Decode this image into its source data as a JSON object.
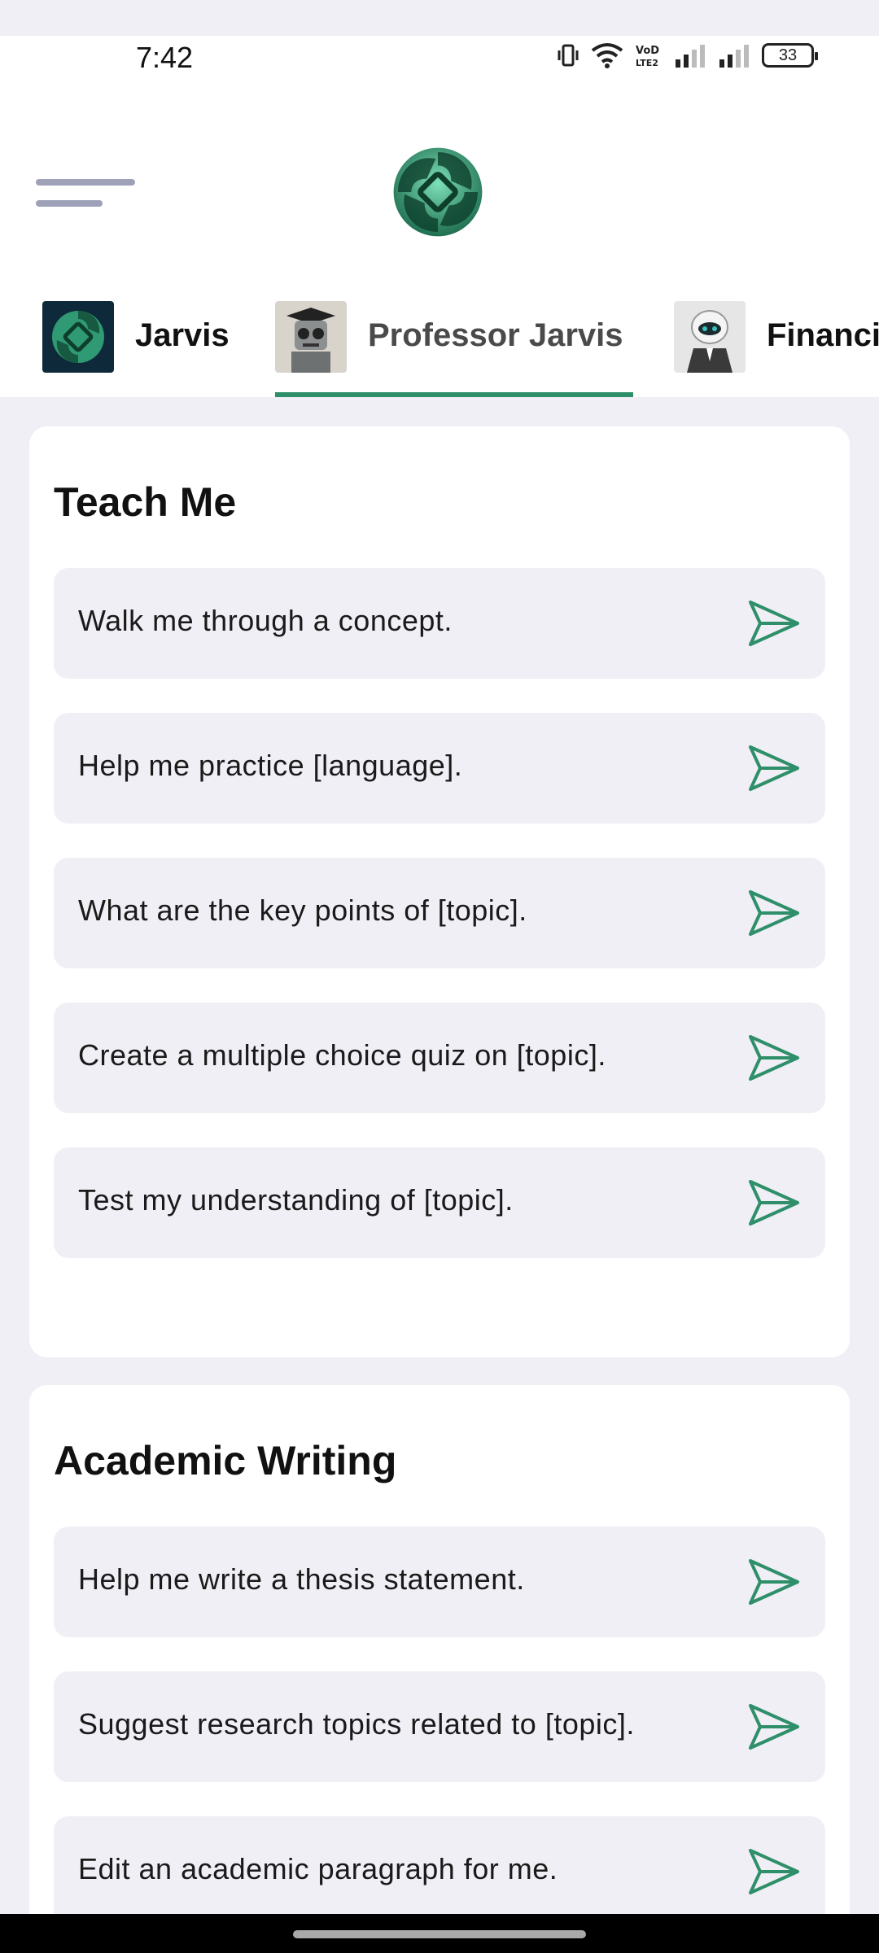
{
  "status": {
    "time": "7:42",
    "battery": "33",
    "icons": [
      "vibrate-icon",
      "wifi-icon",
      "volte-icon",
      "signal-icon",
      "signal-icon",
      "battery-icon"
    ]
  },
  "header": {
    "menu_icon": "hamburger-menu-icon",
    "logo_icon": "jarvis-logo-icon"
  },
  "tabs": [
    {
      "label": "Jarvis",
      "avatar": "jarvis-logo-avatar"
    },
    {
      "label": "Professor Jarvis",
      "avatar": "professor-robot-avatar",
      "active": true
    },
    {
      "label": "Financi",
      "avatar": "finance-robot-avatar"
    }
  ],
  "sections": [
    {
      "title": "Teach Me",
      "prompts": [
        "Walk me through a concept.",
        "Help me practice [language].",
        "What are the key points of [topic].",
        "Create a multiple choice quiz on [topic].",
        "Test my understanding of [topic]."
      ]
    },
    {
      "title": "Academic Writing",
      "prompts": [
        "Help me write a thesis statement.",
        "Suggest research topics related to [topic].",
        "Edit an academic paragraph for me."
      ]
    }
  ],
  "colors": {
    "accent": "#2f8f6a",
    "background": "#efeff5",
    "card": "#ffffff",
    "menu": "#9ea1b8"
  }
}
